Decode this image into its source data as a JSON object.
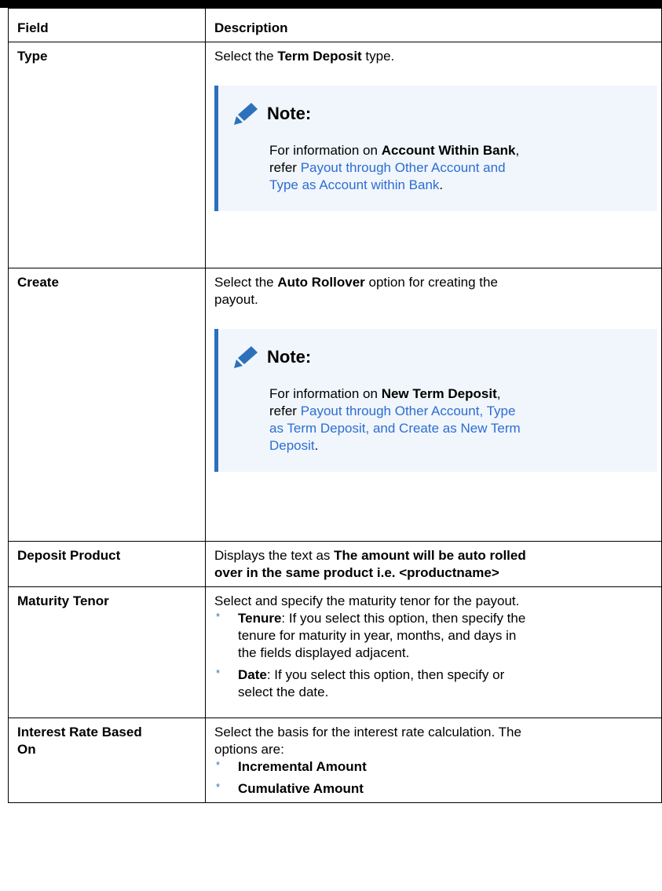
{
  "table": {
    "headers": {
      "field": "Field",
      "description": "Description"
    },
    "rows": {
      "type": {
        "field": "Type",
        "desc": {
          "pre": "Select the ",
          "bold": "Term Deposit",
          "post": " type."
        },
        "note": {
          "title": "Note:",
          "pre": "For information on ",
          "bold": "Account Within Bank",
          "mid": ",",
          "refer": "refer ",
          "link1": "Payout through Other Account and",
          "link2": "Type as Account within Bank",
          "end": "."
        }
      },
      "create": {
        "field": "Create",
        "desc": {
          "pre": "Select the ",
          "bold": "Auto Rollover",
          "post": " option for creating the",
          "line2": "payout."
        },
        "note": {
          "title": "Note:",
          "pre": "For information on ",
          "bold": "New Term Deposit",
          "mid": ",",
          "refer": "refer ",
          "link1": "Payout through Other Account, Type",
          "link2": "as Term Deposit, and Create as New Term",
          "link3": "Deposit",
          "end": "."
        }
      },
      "deposit_product": {
        "field": "Deposit Product",
        "desc": {
          "pre": "Displays the text as ",
          "bold1": "The amount will be auto rolled",
          "bold2": "over in the same product i.e. <productname>"
        }
      },
      "maturity_tenor": {
        "field": "Maturity Tenor",
        "desc": "Select and specify the maturity tenor for the payout.",
        "bullets": [
          {
            "bold": "Tenure",
            "l1": ": If you select this option, then specify the",
            "l2": "tenure for maturity in year, months, and days in",
            "l3": "the fields displayed adjacent."
          },
          {
            "bold": "Date",
            "l1": ": If you select this option, then specify or",
            "l2": "select the date."
          }
        ]
      },
      "interest_rate": {
        "field1": "Interest Rate Based",
        "field2": "On",
        "desc1": "Select the basis for the interest rate calculation. The",
        "desc2": "options are:",
        "bullets": [
          "Incremental Amount",
          "Cumulative Amount"
        ]
      }
    }
  },
  "bullet_symbol": "*",
  "icons": {
    "note": "pencil-icon"
  },
  "colors": {
    "note_bg": "#f1f6fc",
    "note_bar": "#2c71ba",
    "link": "#2c6dd2"
  }
}
